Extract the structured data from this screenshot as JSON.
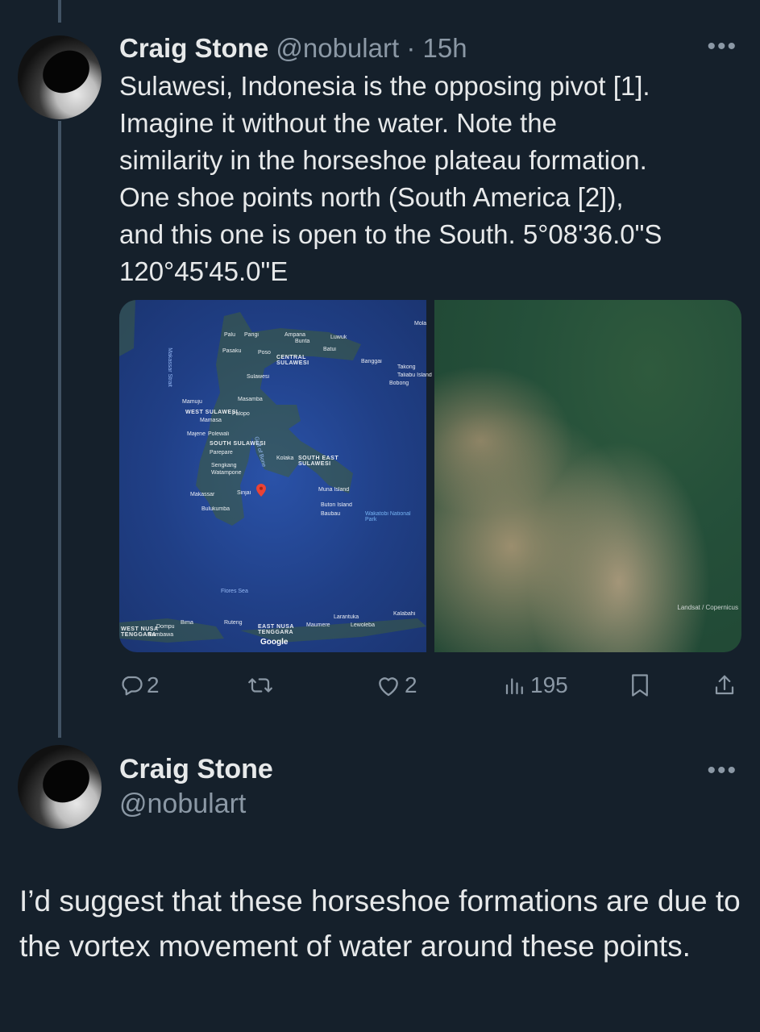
{
  "tweet1": {
    "author_name": "Craig Stone",
    "handle": "@nobulart",
    "separator": "·",
    "time": "15h",
    "text": "Sulawesi, Indonesia is the opposing pivot [1].\nImagine it without the water. Note the\nsimilarity in the horseshoe plateau formation.\nOne shoe points north (South America [2]),\nand this one is open to the South. 5°08'36.0\"S\n120°45'45.0\"E",
    "more_icon": "more-horizontal-icon",
    "media": {
      "map_labels": [
        "Palu",
        "Parigi",
        "Ampana",
        "Luwuk",
        "Banggai",
        "Taliabu Island",
        "Bobong",
        "Poso",
        "Pasaku",
        "CENTRAL SULAWESI",
        "Sulawesi",
        "Masamba",
        "Mamuju",
        "WEST SULAWESI",
        "Mamasa",
        "Palopo",
        "Majene",
        "Polewali",
        "SOUTH SULAWESI",
        "Parepare",
        "Sengkang",
        "Watampone",
        "Kolaka",
        "SOUTH EAST SULAWESI",
        "Makassar",
        "Sinjai",
        "Muna Island",
        "Buton Island",
        "Baubau",
        "Wakatobi National Park",
        "Bulukumba",
        "Flores Sea",
        "WEST NUSA TENGGARA",
        "Sumbawa",
        "Dompu",
        "Bima",
        "Ruteng",
        "EAST NUSA TENGGARA",
        "Maumere",
        "Larantuka",
        "Lewoleba",
        "Kalabahi",
        "Makassar Strait",
        "Gulf of Bone",
        "Luwuk",
        "Bunta",
        "Batui",
        "Takong",
        "Mola"
      ],
      "map_attribution": "Google",
      "sat_attribution": "Landsat / Copernicus"
    },
    "actions": {
      "replies": "2",
      "likes": "2",
      "views": "195",
      "icons": [
        "reply-icon",
        "retweet-icon",
        "like-icon",
        "views-icon",
        "bookmark-icon",
        "share-icon"
      ]
    }
  },
  "tweet2": {
    "author_name": "Craig Stone",
    "handle": "@nobulart",
    "more_icon": "more-horizontal-icon",
    "text": "I’d suggest that these horseshoe formations are due to the vortex movement of water around these points."
  },
  "colors": {
    "background": "#15202b",
    "text": "#e7e9ea",
    "muted": "#8b98a5",
    "thread_line": "#425364"
  }
}
